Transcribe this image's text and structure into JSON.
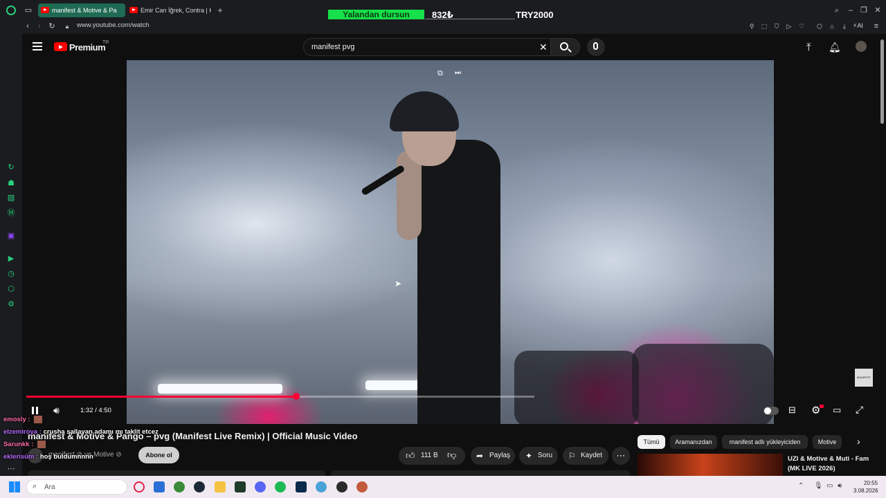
{
  "browser": {
    "tabs": [
      {
        "title": "manifest & Motive & Pa",
        "active": true
      },
      {
        "title": "Emir Can İğrek, Contra | Ko",
        "active": false
      }
    ],
    "new_tab": "+",
    "url": "www.youtube.com/watch",
    "ai_label": "AI"
  },
  "overlay": {
    "banner": "Yalandan dursun",
    "amount": "832₺",
    "currency_goal": "TRY2000"
  },
  "youtube": {
    "logo_text": "Premium",
    "region": "TR",
    "search_value": "manifest pvg",
    "player": {
      "time": "1:32 / 4:50",
      "progress_fraction": 0.532,
      "buffer_fraction": 1.0
    },
    "video_title": "manifest & Motive & Pango – pvg (Manifest Live Remix) | Official Music Video",
    "channel": "manifest",
    "channel_joiner": "ve Motive",
    "subscribe": "Abone ol",
    "like_count": "111 B",
    "share": "Paylaş",
    "ask": "Soru",
    "save": "Kaydet",
    "watermark": "MANIFEST",
    "chips": [
      "Tümü",
      "Aramanızdan",
      "manifest adlı yükleyiciden",
      "Motive"
    ],
    "related": {
      "title_line1": "UZI & Motive & Muti - Fam",
      "title_line2": "(MK LIVE 2026)"
    }
  },
  "chat": [
    {
      "user": "emosly :",
      "text": "",
      "color": "#ff6aa8"
    },
    {
      "user": "elzemiroya :",
      "text": "crusha sallayan adamı mı taklit etcez",
      "color": "#b86bff"
    },
    {
      "user": "Sarunkk :",
      "text": "",
      "color": "#ff6aa8"
    },
    {
      "user": "eklerisüm :",
      "text": "hoş buldumnnnn",
      "color": "#b86bff"
    }
  ],
  "taskbar": {
    "search_placeholder": "Ara",
    "time": "20:55",
    "date": "3.08.2026"
  },
  "colors": {
    "accent_red": "#ff0033",
    "overlay_green": "#16e04a",
    "sidebar_green": "#26d07c"
  }
}
